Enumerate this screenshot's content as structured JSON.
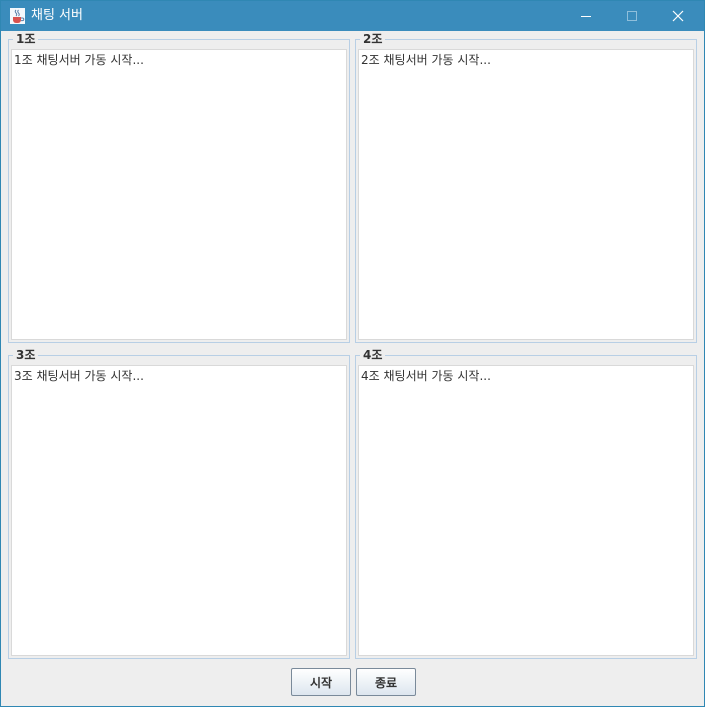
{
  "window": {
    "title": "채팅 서버",
    "title_bar_color": "#3a8cbc"
  },
  "title_buttons": {
    "minimize_icon": "minimize-icon",
    "maximize_icon": "maximize-icon",
    "close_icon": "close-icon"
  },
  "groups": [
    {
      "title": "1조",
      "log": "1조 채팅서버 가동 시작..."
    },
    {
      "title": "2조",
      "log": "2조 채팅서버 가동 시작..."
    },
    {
      "title": "3조",
      "log": "3조 채팅서버 가동 시작..."
    },
    {
      "title": "4조",
      "log": "4조 채팅서버 가동 시작..."
    }
  ],
  "buttons": {
    "start_label": "시작",
    "stop_label": "종료"
  }
}
